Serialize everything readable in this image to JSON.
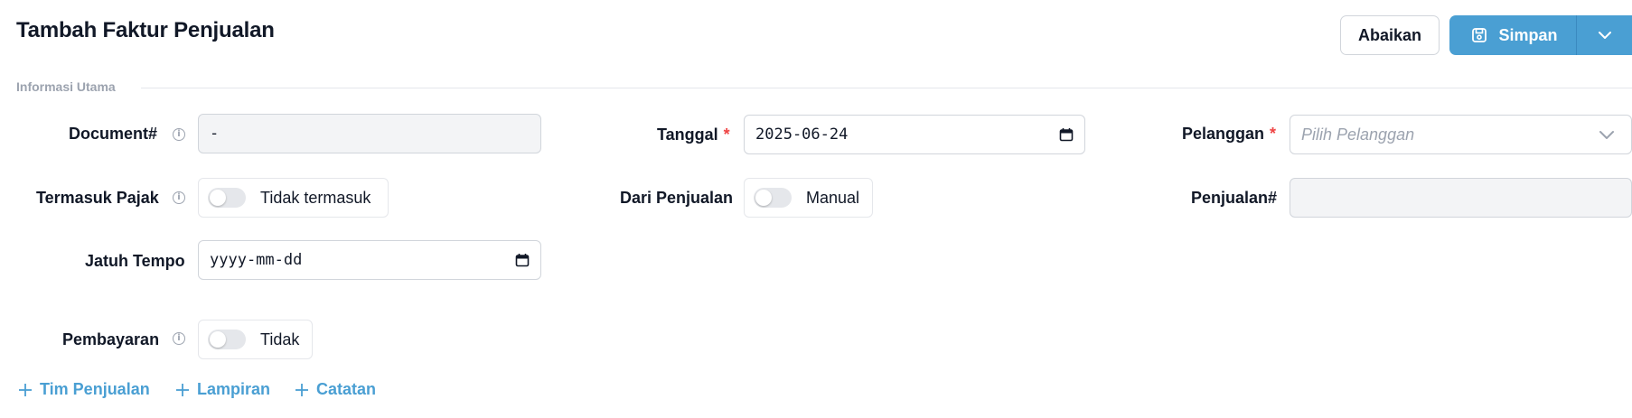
{
  "header": {
    "title": "Tambah Faktur Penjualan",
    "cancel_label": "Abaikan",
    "save_label": "Simpan"
  },
  "section": {
    "title": "Informasi Utama"
  },
  "fields": {
    "document": {
      "label": "Document#",
      "value": "-"
    },
    "tanggal": {
      "label": "Tanggal",
      "required_mark": "*",
      "value": "2025-06-24"
    },
    "pelanggan": {
      "label": "Pelanggan",
      "required_mark": "*",
      "placeholder": "Pilih Pelanggan"
    },
    "termasuk_pajak": {
      "label": "Termasuk Pajak",
      "toggle_text": "Tidak termasuk",
      "checked": false
    },
    "dari_penjualan": {
      "label": "Dari Penjualan",
      "toggle_text": "Manual",
      "checked": false
    },
    "penjualan": {
      "label": "Penjualan#",
      "value": ""
    },
    "jatuh_tempo": {
      "label": "Jatuh Tempo",
      "value": "yyyy-mm-dd"
    },
    "pembayaran": {
      "label": "Pembayaran",
      "toggle_text": "Tidak",
      "checked": false
    }
  },
  "links": {
    "tim_penjualan": "Tim Penjualan",
    "lampiran": "Lampiran",
    "catatan": "Catatan"
  },
  "colors": {
    "accent": "#4a9fd3",
    "required": "#ef4444",
    "muted": "#9ca3af"
  },
  "icons": {
    "info": "info-circle-icon",
    "save": "floppy-disk-icon",
    "caret": "chevron-down-icon",
    "calendar": "calendar-icon",
    "plus": "plus-icon"
  }
}
